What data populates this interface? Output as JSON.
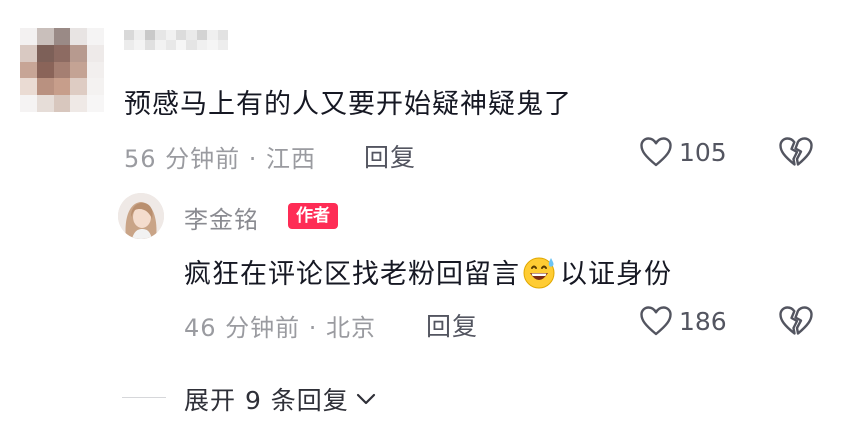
{
  "comments": [
    {
      "text": "预感马上有的人又要开始疑神疑鬼了",
      "meta": "56 分钟前 · 江西",
      "reply_label": "回复",
      "likes": "105",
      "replies": [
        {
          "author": "李金铭",
          "badge": "作者",
          "text_before_emoji": "疯狂在评论区找老粉回留言",
          "emoji": "grinning-sweat-emoji",
          "text_after_emoji": "以证身份",
          "meta": "46 分钟前 · 北京",
          "reply_label": "回复",
          "likes": "186"
        }
      ]
    }
  ],
  "expand_replies": {
    "label": "展开 9 条回复"
  },
  "icons": {
    "like": "heart-outline-icon",
    "dislike": "broken-heart-icon",
    "expand": "chevron-down-icon"
  },
  "colors": {
    "badge": "#fe2c55",
    "meta_text": "#9a9ba0",
    "body_text": "#161823"
  }
}
